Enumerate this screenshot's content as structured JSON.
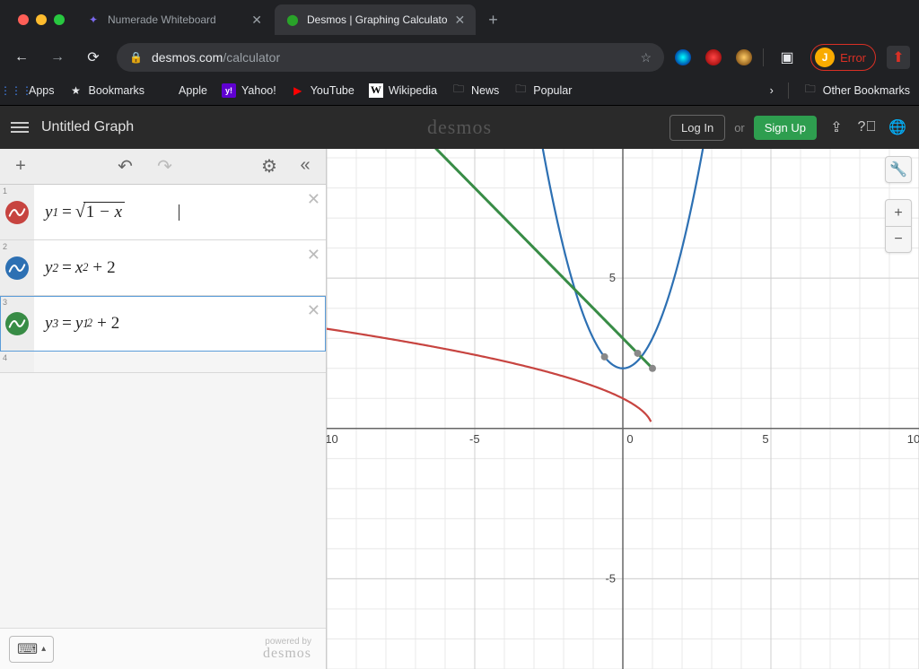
{
  "browser": {
    "tabs": [
      {
        "title": "Numerade Whiteboard",
        "active": false
      },
      {
        "title": "Desmos | Graphing Calculato",
        "active": true
      }
    ],
    "url_host": "desmos.com",
    "url_path": "/calculator",
    "profile_initial": "J",
    "profile_status": "Error",
    "bookmarks": {
      "apps": "Apps",
      "items": [
        "Bookmarks",
        "Apple",
        "Yahoo!",
        "YouTube",
        "Wikipedia",
        "News",
        "Popular"
      ],
      "other": "Other Bookmarks"
    }
  },
  "desmos": {
    "graph_title": "Untitled Graph",
    "logo": "desmos",
    "login": "Log In",
    "or": "or",
    "signup": "Sign Up",
    "powered_top": "powered by",
    "powered_logo": "desmos"
  },
  "expressions": {
    "items": [
      {
        "index": "1",
        "latex_html": "<i>y</i><sub>1</sub><span class=\"eq\">=</span><span class=\"sqrt\"><span class=\"sqrt-sym\">√</span><span class=\"sqrt-body\"><span class=\"num\">1</span> − <i>x</i></span></span>",
        "color": "#c74440"
      },
      {
        "index": "2",
        "latex_html": "<i>y</i><sub>2</sub><span class=\"eq\">=</span><i>x</i><sup>2</sup><span class=\"plus\">+</span><span class=\"num\">2</span>",
        "color": "#2d70b3"
      },
      {
        "index": "3",
        "latex_html": "<i>y</i><sub>3</sub><span class=\"eq\">=</span><i>y</i><sub>1</sub><sup style=\"margin-left:-2px;\">2</sup><span class=\"plus\">+</span><span class=\"num\">2</span>",
        "color": "#388c46",
        "selected": true
      }
    ],
    "empty_index": "4"
  },
  "chart_data": {
    "type": "line",
    "xlim": [
      -10,
      10
    ],
    "ylim": [
      -8,
      9.3
    ],
    "xticks": [
      -10,
      -5,
      0,
      5,
      10
    ],
    "yticks": [
      -5,
      5
    ],
    "grid": true,
    "series": [
      {
        "name": "y1 = √(1−x)",
        "color": "#c74440",
        "values": "sqrt(1-x) for x ≤ 1"
      },
      {
        "name": "y2 = x² + 2",
        "color": "#2d70b3",
        "values": "parabola vertex (0,2)"
      },
      {
        "name": "y3 = y1² + 2 = 3 − x",
        "color": "#388c46",
        "values": "line slope −1 intercept 3, domain x ≤ 1"
      }
    ],
    "intersections": [
      {
        "x": -0.618,
        "y": 2.382
      },
      {
        "x": 0.5,
        "y": 2.5,
        "approx": true
      },
      {
        "x": 1,
        "y": 2
      }
    ]
  }
}
